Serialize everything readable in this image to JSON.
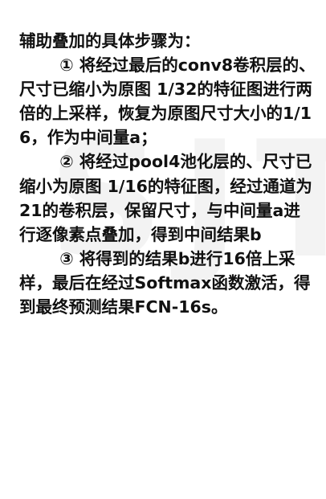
{
  "document": {
    "heading": "辅助叠加的具体步骤为：",
    "steps": [
      "① 将经过最后的conv8卷积层的、尺寸已缩小为原图 1/32的特征图进行两倍的上采样，恢复为原图尺寸大小的1/16，作为中间量a；",
      "② 将经过pool4池化层的、尺寸已缩小为原图 1/16的特征图，经过通道为21的卷积层，保留尺寸，与中间量a进行逐像素点叠加，得到中间结果b",
      "③ 将得到的结果b进行16倍上采样，最后在经过Softmax函数激活，得到最终预测结果FCN-16s。"
    ]
  }
}
